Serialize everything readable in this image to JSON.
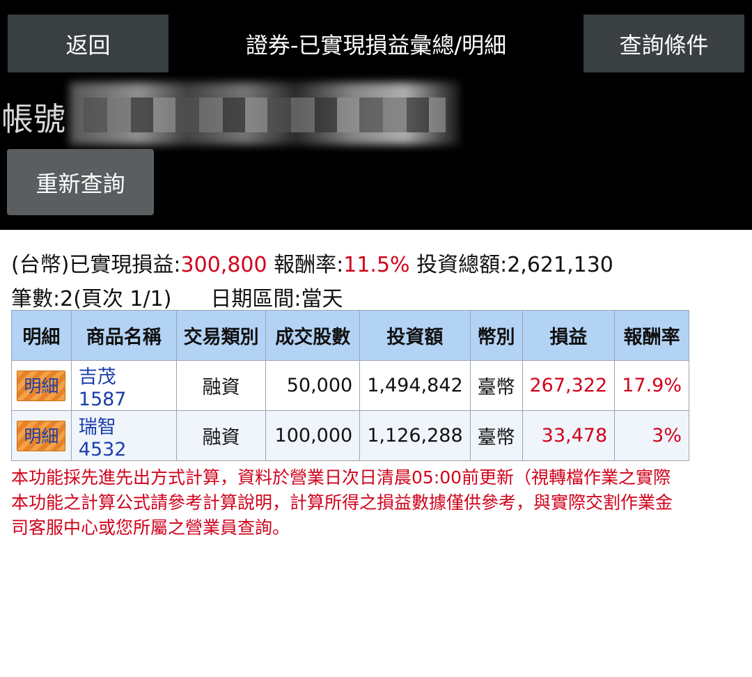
{
  "header": {
    "back_label": "返回",
    "title": "證券-已實現損益彙總/明細",
    "query_conditions_label": "查詢條件"
  },
  "account": {
    "label": "帳號"
  },
  "requery_label": "重新查詢",
  "summary": {
    "currency_prefix": "(台幣)已實現損益:",
    "realized_pl": "300,800",
    "return_label": " 報酬率:",
    "return_rate": "11.5%",
    "investment_label": " 投資總額:2,621,130",
    "count_text": "筆數:2(頁次 1/1)",
    "date_range_text": "日期區間:當天"
  },
  "table": {
    "headers": [
      "明細",
      "商品名稱",
      "交易類別",
      "成交股數",
      "投資額",
      "幣別",
      "損益",
      "報酬率"
    ],
    "rows": [
      {
        "detail": "明細",
        "product": "吉茂 1587",
        "type": "融資",
        "shares": "50,000",
        "investment": "1,494,842",
        "currency": "臺幣",
        "pl": "267,322",
        "rate": "17.9%"
      },
      {
        "detail": "明細",
        "product": "瑞智 4532",
        "type": "融資",
        "shares": "100,000",
        "investment": "1,126,288",
        "currency": "臺幣",
        "pl": "33,478",
        "rate": "3%"
      }
    ]
  },
  "notes": {
    "line1": "本功能採先進先出方式計算，資料於營業日次日清晨05:00前更新（視轉檔作業之實際",
    "line2": "本功能之計算公式請參考計算說明，計算所得之損益數據僅供參考，與實際交割作業金",
    "line3": "司客服中心或您所屬之營業員查詢。"
  },
  "colors": {
    "top_background": "#000000",
    "button_background": "#3a3f42",
    "table_header": "#b3d3f5",
    "profit_red": "#d0021b",
    "product_blue": "#1a3ea8",
    "detail_button_orange": "#e8822a"
  }
}
